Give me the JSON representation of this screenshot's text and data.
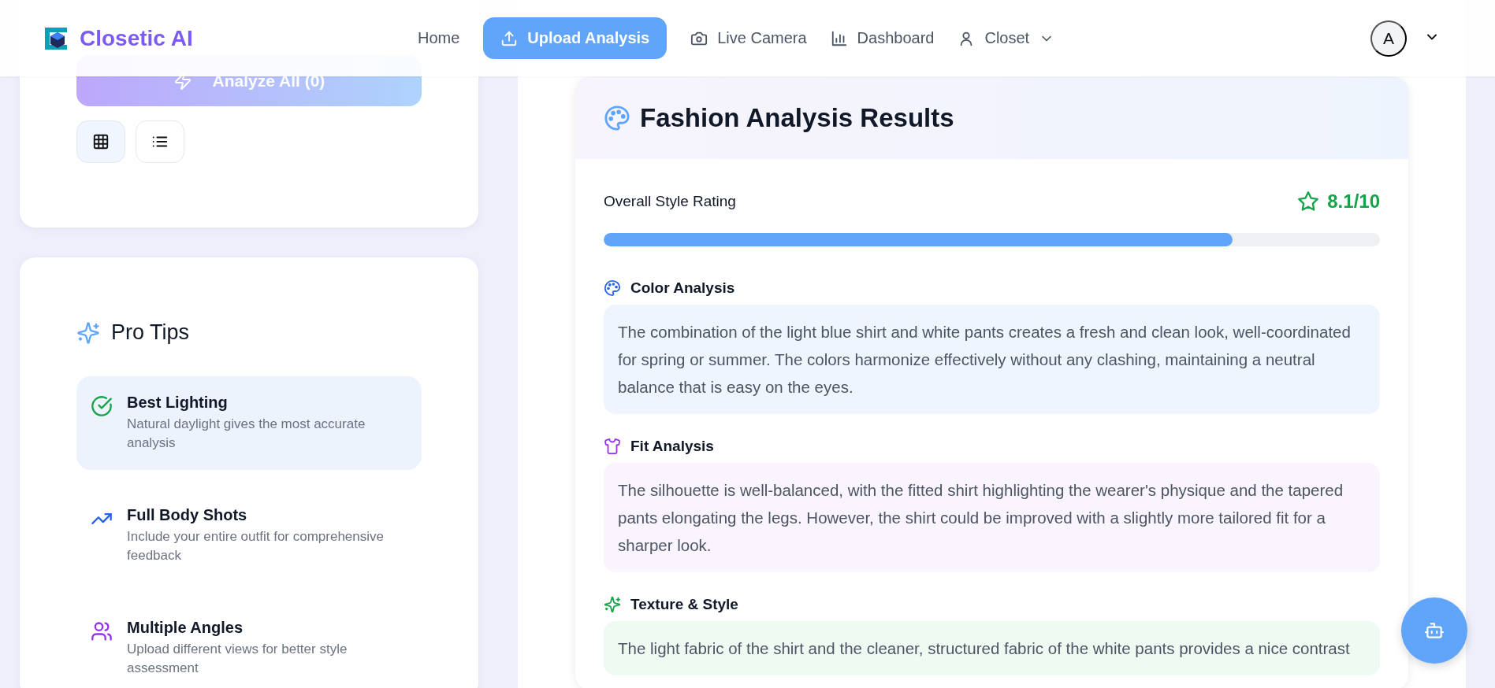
{
  "header": {
    "brand": "Closetic AI",
    "nav": [
      {
        "label": "Home",
        "kind": "plain",
        "selected": false
      },
      {
        "label": "Upload Analysis",
        "kind": "upload",
        "selected": true
      },
      {
        "label": "Live Camera",
        "kind": "camera",
        "selected": false
      },
      {
        "label": "Dashboard",
        "kind": "chart",
        "selected": false
      },
      {
        "label": "Closet",
        "kind": "menu",
        "selected": false
      }
    ],
    "avatar": "A"
  },
  "upload_panel": {
    "analyze_button": {
      "label": "Analyze All (0)",
      "disabled": true
    },
    "view_toggle": [
      {
        "kind": "grid",
        "selected": true
      },
      {
        "kind": "list",
        "selected": false
      }
    ]
  },
  "pro_tips": {
    "title": "Pro Tips",
    "tips": [
      {
        "kind": "check",
        "title": "Best Lighting",
        "text": "Natural daylight gives the most accurate analysis",
        "selected": true
      },
      {
        "kind": "trend",
        "title": "Full Body Shots",
        "text": "Include your entire outfit for comprehensive feedback",
        "selected": false
      },
      {
        "kind": "people",
        "title": "Multiple Angles",
        "text": "Upload different views for better style assessment",
        "selected": false
      }
    ]
  },
  "results": {
    "title": "Fashion Analysis Results",
    "rating": {
      "label": "Overall Style Rating",
      "value": "8.1/10",
      "level": 0.81
    },
    "sections": [
      {
        "kind": "color",
        "title": "Color Analysis",
        "text": "The combination of the light blue shirt and white pants creates a fresh and clean look, well-coordinated for spring or summer. The colors harmonize effectively without any clashing, maintaining a neutral balance that is easy on the eyes."
      },
      {
        "kind": "fit",
        "title": "Fit Analysis",
        "text": "The silhouette is well-balanced, with the fitted shirt highlighting the wearer's physique and the tapered pants elongating the legs. However, the shirt could be improved with a slightly more tailored fit for a sharper look."
      },
      {
        "kind": "texture",
        "title": "Texture & Style",
        "text": "The light fabric of the shirt and the cleaner, structured fabric of the white pants provides a nice contrast"
      }
    ]
  }
}
